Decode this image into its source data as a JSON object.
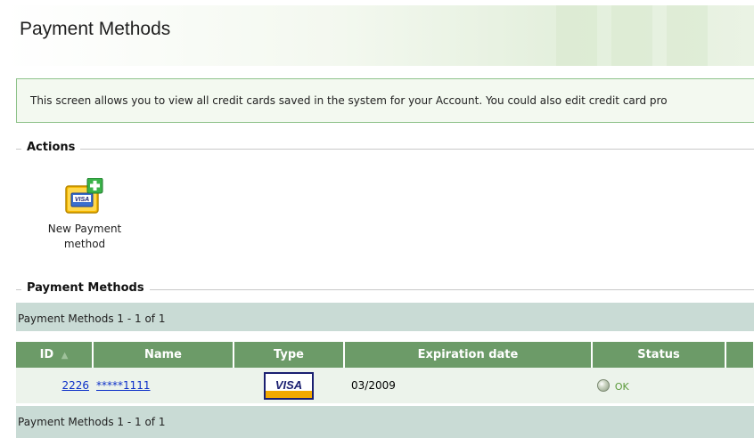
{
  "header": {
    "title": "Payment Methods"
  },
  "info": {
    "text": "This screen allows you to view all credit cards saved in the system for your Account. You could also edit credit card pro"
  },
  "actions": {
    "label": "Actions",
    "new_payment_line1": "New Payment",
    "new_payment_line2": "method"
  },
  "list": {
    "label": "Payment Methods",
    "pager_top": "Payment Methods 1 - 1 of 1",
    "pager_bottom": "Payment Methods 1 - 1 of 1",
    "columns": {
      "id": "ID",
      "name": "Name",
      "type": "Type",
      "expiration": "Expiration date",
      "status": "Status"
    },
    "sort_indicator": "▲",
    "rows": [
      {
        "id": "2226",
        "name": "*****1111",
        "type": "VISA",
        "expiration": "03/2009",
        "status": "OK"
      }
    ]
  },
  "colors": {
    "table_header": "#6c9b68",
    "pager_bar": "#c9dbd5",
    "row_bg": "#ecf3eb",
    "link": "#0b2fc8",
    "info_border": "#8ec28a"
  }
}
